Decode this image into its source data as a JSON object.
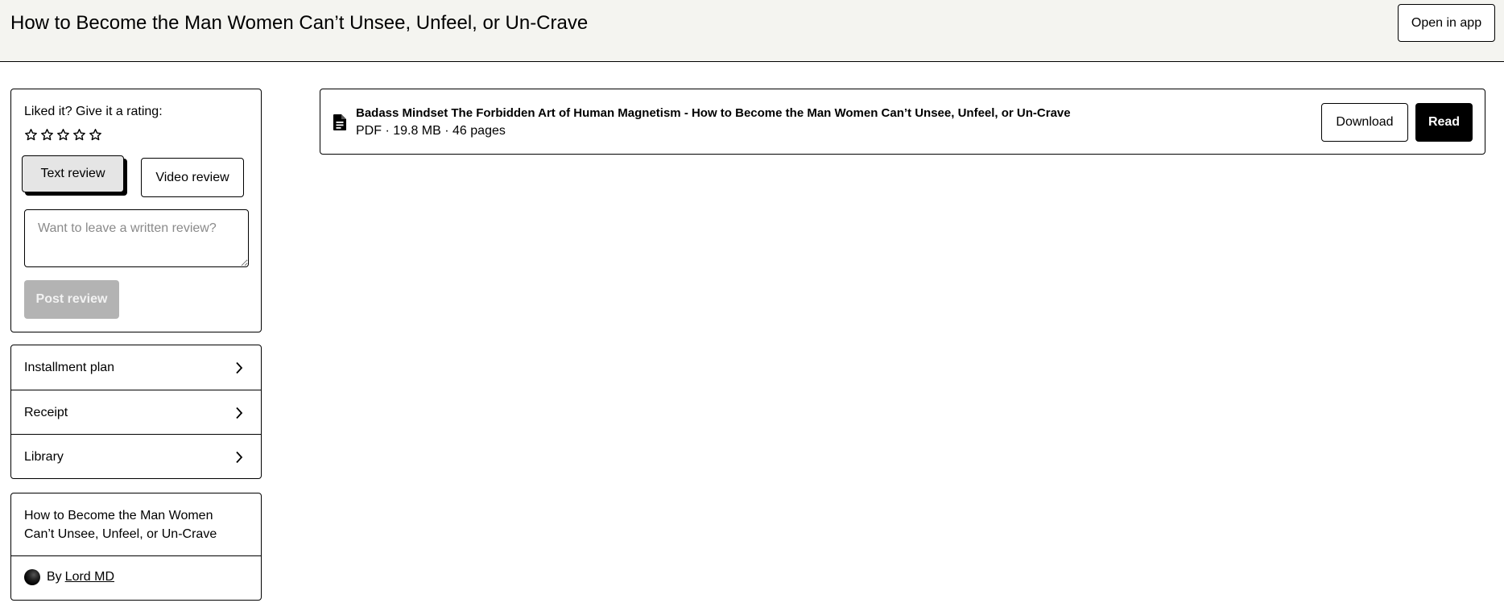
{
  "header": {
    "title": "How to Become the Man Women Can’t Unsee, Unfeel, or Un-Crave",
    "open_app_label": "Open in app"
  },
  "rating": {
    "prompt": "Liked it? Give it a rating:",
    "star_count": 5,
    "stars_selected": 0,
    "star_icon": "star-outline-icon",
    "text_review_label": "Text review",
    "video_review_label": "Video review",
    "review_placeholder": "Want to leave a written review?",
    "post_review_label": "Post review"
  },
  "menu": {
    "items": [
      {
        "label": "Installment plan",
        "icon": "chevron-right-icon"
      },
      {
        "label": "Receipt",
        "icon": "chevron-right-icon"
      },
      {
        "label": "Library",
        "icon": "chevron-right-icon"
      }
    ]
  },
  "product": {
    "title": "How to Become the Man Women Can’t Unsee, Unfeel, or Un-Crave",
    "by_label": "By",
    "creator": "Lord MD"
  },
  "file": {
    "icon": "document-icon",
    "name": "Badass Mindset The Forbidden Art of Human Magnetism - How to Become the Man Women Can’t Unsee, Unfeel, or Un-Crave",
    "meta": "PDF · 19.8 MB · 46 pages",
    "download_label": "Download",
    "read_label": "Read"
  },
  "colors": {
    "header_bg": "#f4f4f0",
    "border": "#000000",
    "disabled_button": "#b3b3b3",
    "primary_button": "#000000",
    "selected_tab_bg": "#e5e5e5"
  }
}
